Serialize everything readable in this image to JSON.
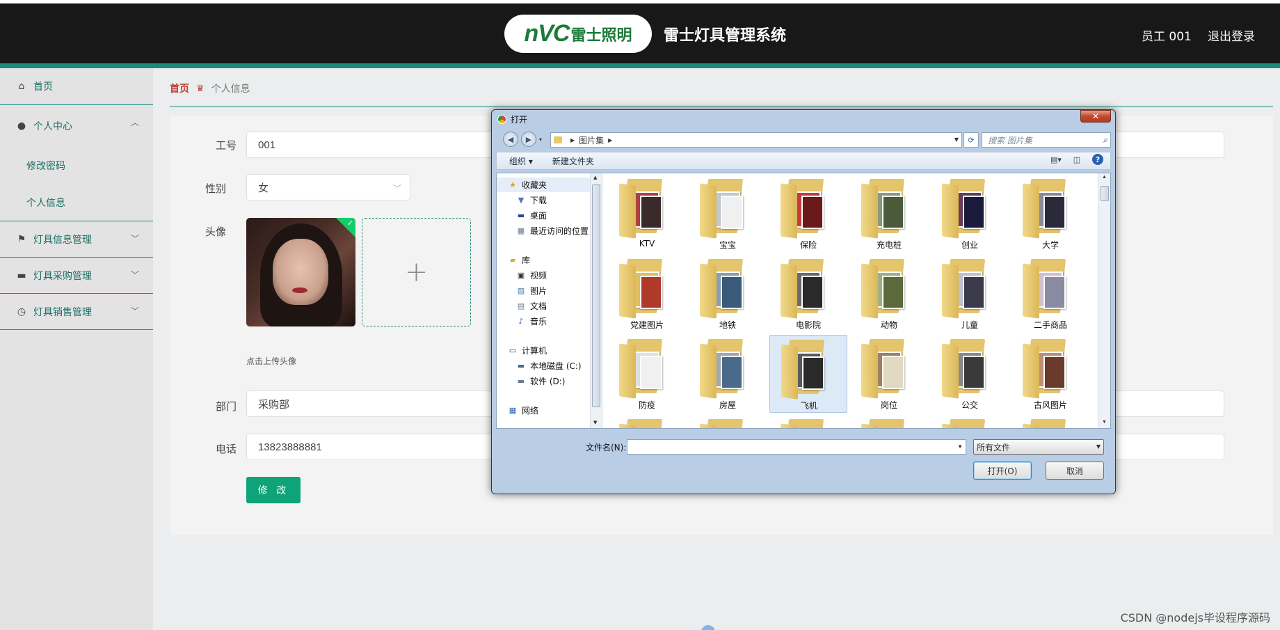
{
  "header": {
    "logo_nvc": "nVC",
    "logo_cn": "雷士照明",
    "title": "雷士灯具管理系统",
    "user": "员工 001",
    "logout": "退出登录"
  },
  "sidebar": {
    "home": "首页",
    "personal_center": "个人中心",
    "change_password": "修改密码",
    "personal_info": "个人信息",
    "lamp_info": "灯具信息管理",
    "lamp_purchase": "灯具采购管理",
    "lamp_sales": "灯具销售管理"
  },
  "breadcrumb": {
    "home": "首页",
    "current": "个人信息"
  },
  "form": {
    "id_label": "工号",
    "id_value": "001",
    "gender_label": "性别",
    "gender_value": "女",
    "avatar_label": "头像",
    "upload_hint": "点击上传头像",
    "dept_label": "部门",
    "dept_value": "采购部",
    "phone_label": "电话",
    "phone_value": "13823888881",
    "submit": "修 改"
  },
  "dialog": {
    "title": "打开",
    "path": "图片集",
    "search_placeholder": "搜索 图片集",
    "toolbar_organize": "组织 ▾",
    "toolbar_new_folder": "新建文件夹",
    "tree": {
      "favorites": "收藏夹",
      "downloads": "下载",
      "desktop": "桌面",
      "recent": "最近访问的位置",
      "libraries": "库",
      "videos": "视频",
      "pictures": "图片",
      "documents": "文档",
      "music": "音乐",
      "computer": "计算机",
      "drive_c": "本地磁盘 (C:)",
      "drive_d": "软件 (D:)",
      "network": "网络"
    },
    "folders": [
      "KTV",
      "宝宝",
      "保险",
      "充电桩",
      "创业",
      "大学",
      "党建图片",
      "地铁",
      "电影院",
      "动物",
      "儿童",
      "二手商品",
      "防疫",
      "房屋",
      "飞机",
      "岗位",
      "公交",
      "古风图片"
    ],
    "filename_label": "文件名(N):",
    "filename_value": "",
    "filter": "所有文件",
    "open_button": "打开(O)",
    "cancel_button": "取消"
  },
  "watermark": "CSDN @nodejs毕设程序源码",
  "colors": {
    "accent": "#1a8c7c",
    "button": "#0fa37a",
    "header_bg": "#181818"
  }
}
